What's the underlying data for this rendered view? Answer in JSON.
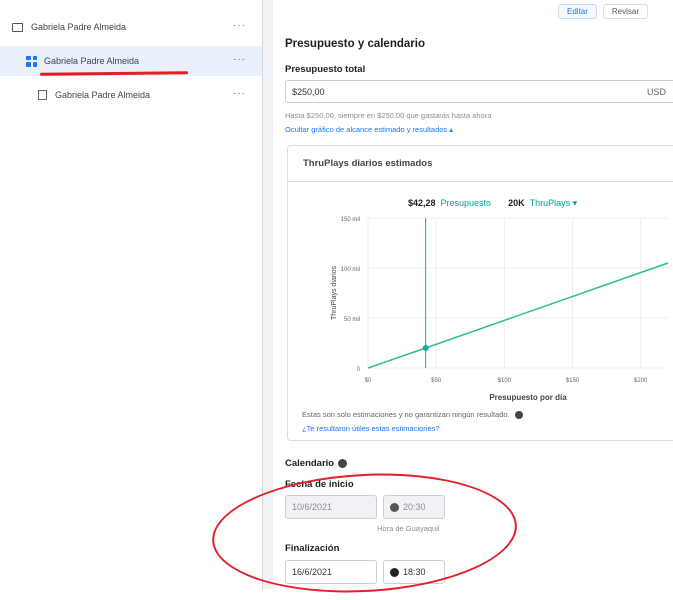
{
  "tree": {
    "items": [
      {
        "label": "Gabriela Padre Almeida",
        "kind": "campaign"
      },
      {
        "label": "Gabriela Padre Almeida",
        "kind": "adset"
      },
      {
        "label": "Gabriela Padre Almeida",
        "kind": "ad"
      }
    ],
    "more": "···"
  },
  "toolbar": {
    "edit_label": "Editar",
    "review_label": "Revisar"
  },
  "section": {
    "title": "Presupuesto y calendario",
    "budget_label": "Presupuesto total",
    "budget_value": "$250,00",
    "currency": "USD",
    "budget_help": "Hasta $250,00, siempre en $250,00 que gastarás hasta ahora",
    "toggle_link": "Ocultar gráfico de alcance estimado y resultados ▴"
  },
  "estimate_card": {
    "header": "ThruPlays diarios estimados",
    "summary_amount": "$42,28",
    "summary_amount_label": "Presupuesto",
    "summary_count": "20K",
    "summary_count_label": "ThruPlays ▾",
    "disclaimer": "Estas son solo estimaciones y no garantizan ningún resultado.",
    "feedback_link": "¿Te resultaron útiles estas estimaciones?"
  },
  "chart_data": {
    "type": "line",
    "xlabel": "Presupuesto por día",
    "ylabel": "ThruPlays diarios",
    "x_ticks": [
      "$0",
      "$50",
      "$100",
      "$150",
      "$200"
    ],
    "y_ticks": [
      "0",
      "50 mil",
      "100 mil",
      "150 mil"
    ],
    "xlim": [
      0,
      220
    ],
    "ylim": [
      0,
      150
    ],
    "series": [
      {
        "x": [
          0,
          42.28,
          220
        ],
        "y": [
          0,
          20,
          105
        ]
      }
    ],
    "marker": {
      "x": 42.28,
      "y": 20
    },
    "colors": {
      "line": "#2bbd8e",
      "marker_line": "#19a7a7"
    }
  },
  "schedule": {
    "title": "Calendario",
    "start_label": "Fecha de inicio",
    "start_date": "10/6/2021",
    "start_time": "20:30",
    "timezone_note": "Hora de Guayaquil",
    "end_label": "Finalización",
    "end_date": "16/6/2021",
    "end_time": "18:30"
  }
}
